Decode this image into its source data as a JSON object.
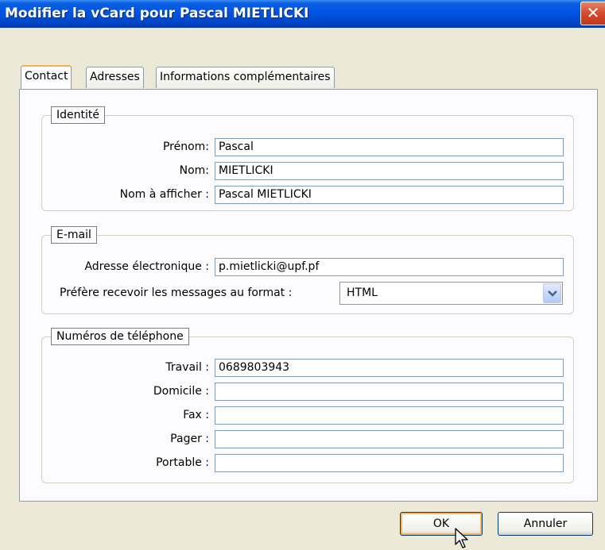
{
  "window": {
    "title": "Modifier la vCard pour Pascal MIETLICKI",
    "close_glyph": "✕"
  },
  "tabs": [
    {
      "label": "Contact",
      "active": true
    },
    {
      "label": "Adresses",
      "active": false
    },
    {
      "label": "Informations complémentaires",
      "active": false
    }
  ],
  "identity": {
    "legend": "Identité",
    "first_name_label": "Prénom:",
    "first_name_value": "Pascal",
    "last_name_label": "Nom:",
    "last_name_value": "MIETLICKI",
    "display_name_label": "Nom à afficher :",
    "display_name_value": "Pascal MIETLICKI"
  },
  "email": {
    "legend": "E-mail",
    "address_label": "Adresse électronique :",
    "address_value": "p.mietlicki@upf.pf",
    "format_label": "Préfère recevoir les messages au format :",
    "format_value": "HTML"
  },
  "phones": {
    "legend": "Numéros de téléphone",
    "work_label": "Travail :",
    "work_value": "0689803943",
    "home_label": "Domicile :",
    "home_value": "",
    "fax_label": "Fax :",
    "fax_value": "",
    "pager_label": "Pager :",
    "pager_value": "",
    "mobile_label": "Portable :",
    "mobile_value": ""
  },
  "buttons": {
    "ok": "OK",
    "cancel": "Annuler"
  },
  "colors": {
    "titlebar": "#0054e3",
    "dialog_bg": "#ece9d8",
    "panel_bg": "#fcfcfe",
    "field_border": "#7f9db9",
    "close_red": "#d24a2b",
    "focus_orange": "#f9b35a"
  },
  "icons": {
    "close": "close-icon",
    "dropdown": "chevron-down-icon",
    "cursor": "mouse-pointer-icon"
  }
}
